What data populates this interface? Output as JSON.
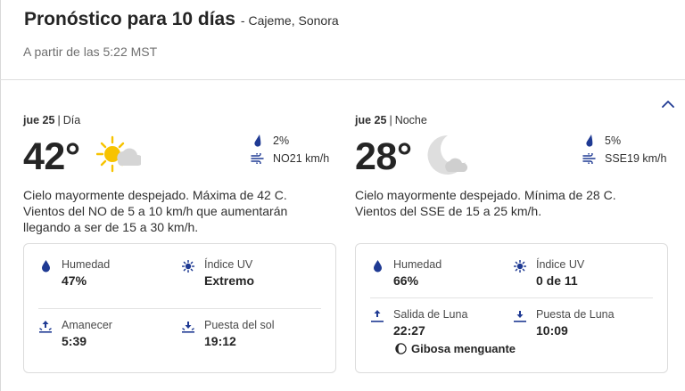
{
  "header": {
    "title": "Pronóstico para 10 días",
    "location": "- Cajeme, Sonora",
    "timestamp": "A partir de las 5:22 MST"
  },
  "colors": {
    "accent": "#1b4de0",
    "icon_blue": "#1f3a93",
    "sun": "#f7c300",
    "cloud": "#d5d5d5",
    "moon": "#d5d5d5"
  },
  "day": {
    "date": "jue 25",
    "period": "Día",
    "temperature": "42°",
    "condition_icon": "sun-cloud-icon",
    "precip": "2%",
    "wind": "NO21 km/h",
    "description": "Cielo mayormente despejado. Máxima de 42 C. Vientos del NO de 5 a 10 km/h que aumentarán llegando a ser de 15 a 30 km/h.",
    "details": {
      "humidity_label": "Humedad",
      "humidity_value": "47%",
      "uv_label": "Índice UV",
      "uv_value": "Extremo",
      "sunrise_label": "Amanecer",
      "sunrise_value": "5:39",
      "sunset_label": "Puesta del sol",
      "sunset_value": "19:12"
    }
  },
  "night": {
    "date": "jue 25",
    "period": "Noche",
    "temperature": "28°",
    "condition_icon": "moon-cloud-icon",
    "precip": "5%",
    "wind": "SSE19 km/h",
    "description": "Cielo mayormente despejado. Mínima de 28 C. Vientos del SSE de 15 a 25 km/h.",
    "details": {
      "humidity_label": "Humedad",
      "humidity_value": "66%",
      "uv_label": "Índice UV",
      "uv_value": "0 de 11",
      "moonrise_label": "Salida de Luna",
      "moonrise_value": "22:27",
      "moonset_label": "Puesta de Luna",
      "moonset_value": "10:09",
      "moon_phase": "Gibosa menguante"
    }
  }
}
